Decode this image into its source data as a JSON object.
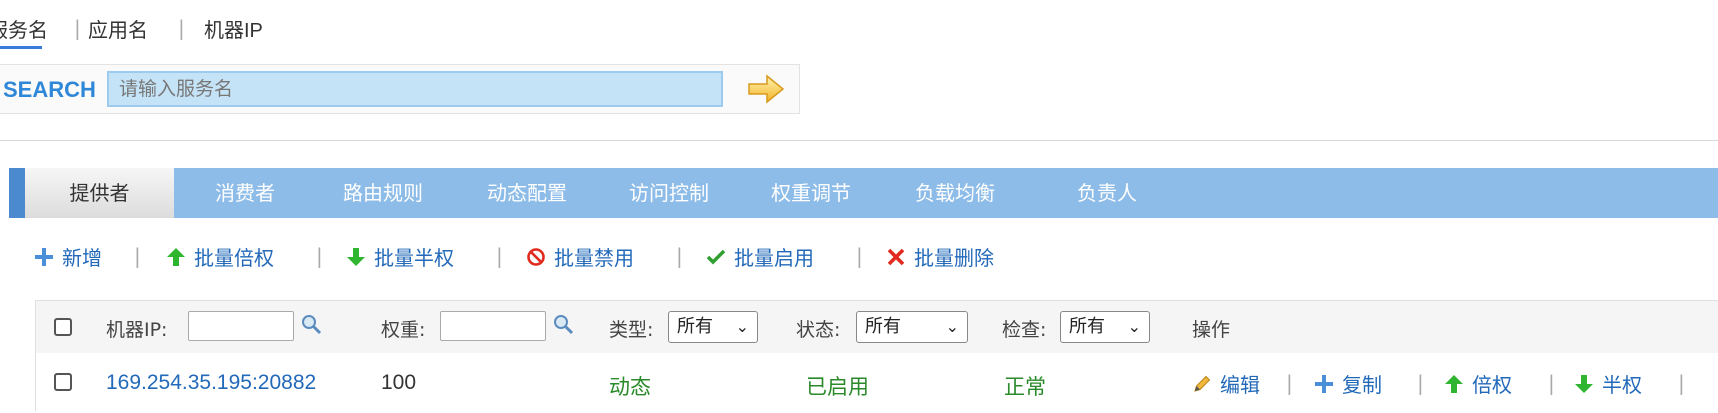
{
  "search_tabs": {
    "service": "服务名",
    "app": "应用名",
    "ip": "机器IP",
    "separator": "|"
  },
  "search": {
    "label": "SEARCH",
    "placeholder": "请输入服务名"
  },
  "nav_tabs": [
    "提供者",
    "消费者",
    "路由规则",
    "动态配置",
    "访问控制",
    "权重调节",
    "负载均衡",
    "负责人"
  ],
  "toolbar": {
    "add": "新增",
    "batch_double": "批量倍权",
    "batch_half": "批量半权",
    "batch_disable": "批量禁用",
    "batch_enable": "批量启用",
    "batch_delete": "批量删除",
    "separator": "|"
  },
  "table": {
    "filters": {
      "ip_label": "机器IP:",
      "weight_label": "权重:",
      "type_label": "类型:",
      "type_value": "所有",
      "status_label": "状态:",
      "status_value": "所有",
      "check_label": "检查:",
      "check_value": "所有",
      "ops_label": "操作"
    },
    "rows": [
      {
        "address": "169.254.35.195:20882",
        "weight": "100",
        "type": "动态",
        "status": "已启用",
        "check": "正常",
        "ops": [
          "编辑",
          "复制",
          "倍权",
          "半权"
        ]
      }
    ]
  },
  "colors": {
    "nav_bg": "#8ebce8",
    "accent": "#2f87d8",
    "link": "#2369b9",
    "green": "#2a8a2a",
    "delete": "#e02b1e"
  }
}
